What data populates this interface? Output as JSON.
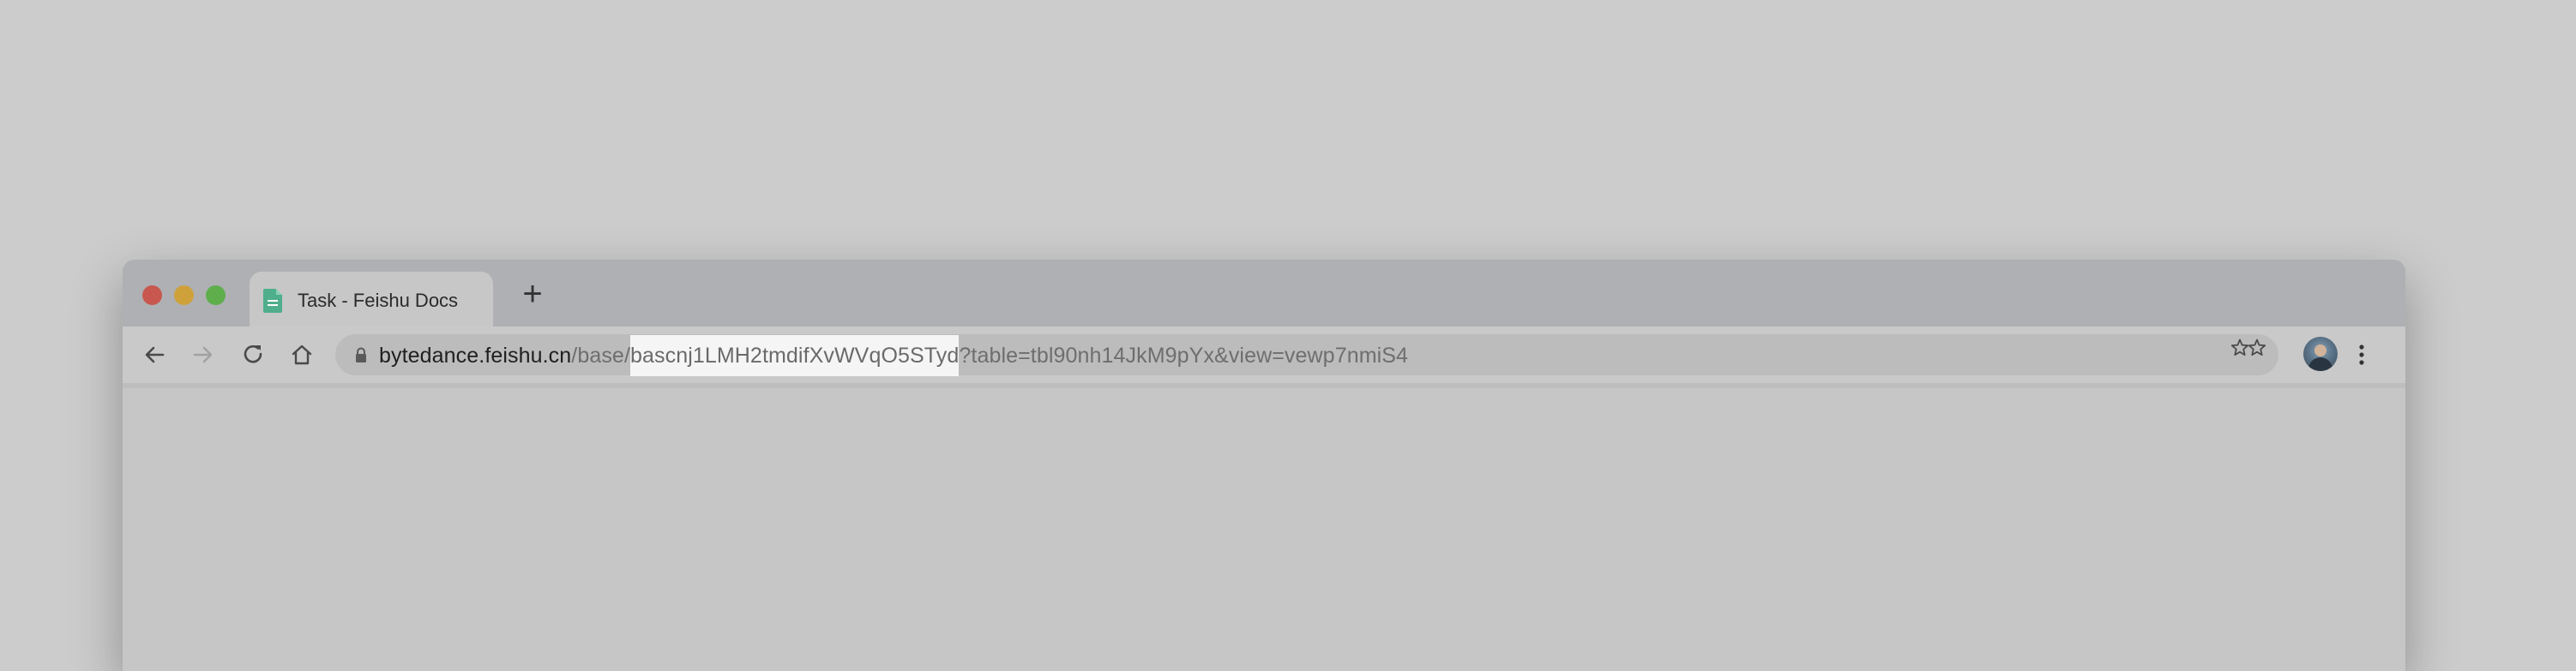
{
  "tab": {
    "title": "Task - Feishu Docs",
    "icon": "feishu-doc-icon"
  },
  "new_tab": {
    "label": "+"
  },
  "address_bar": {
    "host": "bytedance.feishu.cn",
    "path_prefix": "/base/",
    "selected_segment": "bascnj1LMH2tmdifXvWVqO5STyd",
    "query": "?table=tbl90nh14JkM9pYx&view=vewp7nmiS4"
  },
  "colors": {
    "close": "#c8584f",
    "minimize": "#cfa13b",
    "maximize": "#5fae4c",
    "doc_icon": "#4fae8c"
  }
}
